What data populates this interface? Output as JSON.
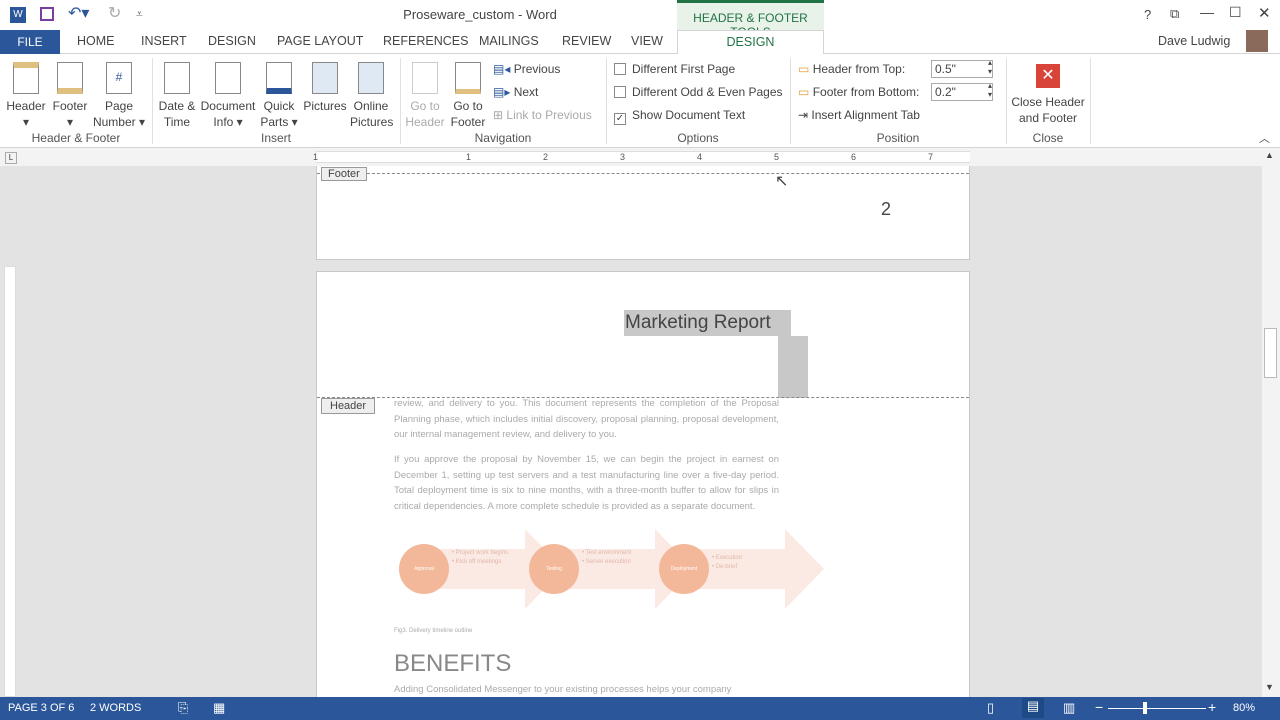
{
  "titlebar": {
    "title": "Proseware_custom - Word",
    "context_tab": "HEADER & FOOTER TOOLS",
    "help": "?",
    "user": "Dave Ludwig"
  },
  "tabs": [
    "FILE",
    "HOME",
    "INSERT",
    "DESIGN",
    "PAGE LAYOUT",
    "REFERENCES",
    "MAILINGS",
    "REVIEW",
    "VIEW",
    "DESIGN"
  ],
  "ribbon": {
    "header_footer": {
      "header": "Header",
      "footer": "Footer",
      "page_number": "Page Number",
      "group": "Header & Footer"
    },
    "insert": {
      "date_time": "Date & Time",
      "doc_info": "Document Info",
      "quick_parts": "Quick Parts",
      "pictures": "Pictures",
      "online_pictures": "Online Pictures",
      "group": "Insert"
    },
    "navigation": {
      "go_header": "Go to Header",
      "go_footer": "Go to Footer",
      "previous": "Previous",
      "next": "Next",
      "link_previous": "Link to Previous",
      "group": "Navigation"
    },
    "options": {
      "diff_first": "Different First Page",
      "diff_odd_even": "Different Odd & Even Pages",
      "show_doc_text": "Show Document Text",
      "show_doc_text_checked": true,
      "group": "Options"
    },
    "position": {
      "header_from_top": "Header from Top:",
      "header_value": "0.5\"",
      "footer_from_bottom": "Footer from Bottom:",
      "footer_value": "0.2\"",
      "insert_align_tab": "Insert Alignment Tab",
      "group": "Position"
    },
    "close": {
      "label": "Close Header and Footer",
      "group": "Close"
    }
  },
  "ruler": {
    "numbers": [
      "1",
      "1",
      "2",
      "3",
      "4",
      "5",
      "6",
      "7"
    ]
  },
  "document": {
    "footer_tag": "Footer",
    "page_number": "2",
    "header_title": "Marketing Report",
    "header_tag": "Header",
    "para1": "review, and delivery to you. This document represents the completion of the Proposal Planning phase, which includes initial discovery, proposal planning, proposal development, our internal management review, and delivery to you.",
    "para2": "If you approve the proposal by November 15, we can begin the project in earnest on December 1, setting up test servers and a test manufacturing line over a five-day period. Total deployment time is six to nine months, with a three-month buffer to allow for slips in critical dependencies. A more complete schedule is provided as a separate document.",
    "diagram": [
      {
        "label": "Approval",
        "bullets": "• Project work begins\n• Kick off meetings"
      },
      {
        "label": "Testing",
        "bullets": "• Test environment\n• Server execution"
      },
      {
        "label": "Deployment",
        "bullets": "• Execution\n• De-brief"
      }
    ],
    "caption": "Fig3. Delivery timeline outline",
    "heading": "BENEFITS",
    "para3": "Adding Consolidated Messenger to your existing processes helps your company"
  },
  "status": {
    "page": "PAGE 3 OF 6",
    "words": "2 WORDS",
    "zoom": "80%"
  },
  "colors": {
    "accent": "#2b579a",
    "context": "#217346",
    "close": "#d9443a"
  }
}
